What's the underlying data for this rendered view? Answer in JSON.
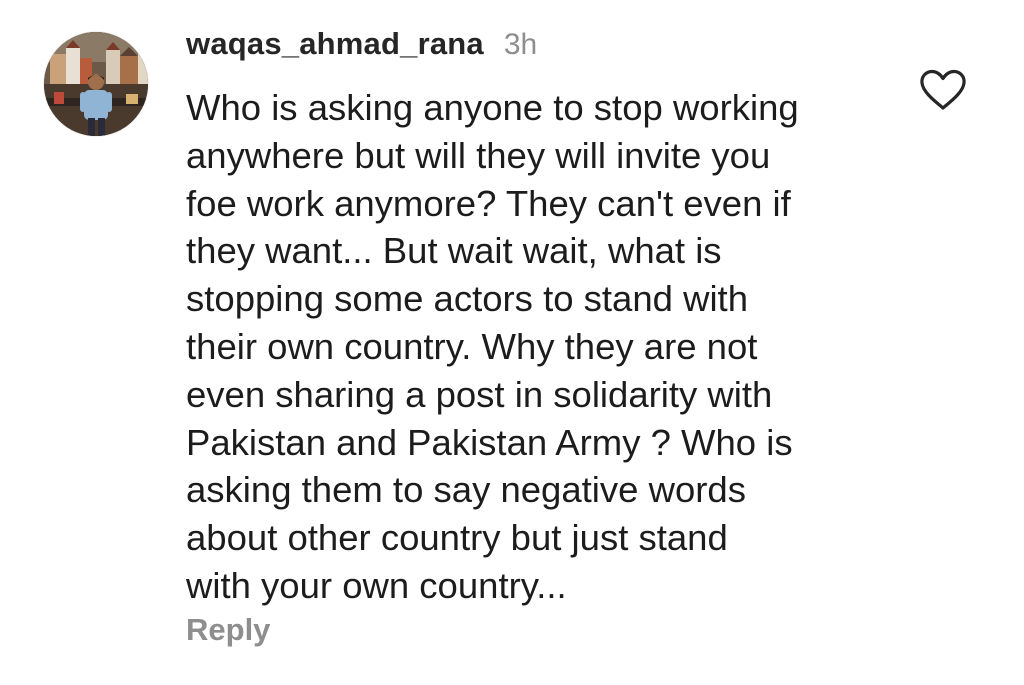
{
  "comment": {
    "username": "waqas_ahmad_rana",
    "timestamp": "3h",
    "text_lines": [
      "Who is asking anyone to stop working",
      "anywhere but will they will invite you",
      "foe work anymore? They can't even if",
      "they want... But wait wait, what is",
      "stopping some actors to stand with",
      "their own country. Why they are not",
      "even sharing a post in solidarity with",
      "Pakistan and Pakistan Army ? Who is",
      "asking them to say negative words",
      "about other country but just stand",
      "with your own country..."
    ],
    "reply_label": "Reply",
    "like_icon": "heart-outline-icon"
  },
  "colors": {
    "background": "#ffffff",
    "text": "#1c1c1c",
    "username": "#262626",
    "muted": "#8e8e8e"
  }
}
